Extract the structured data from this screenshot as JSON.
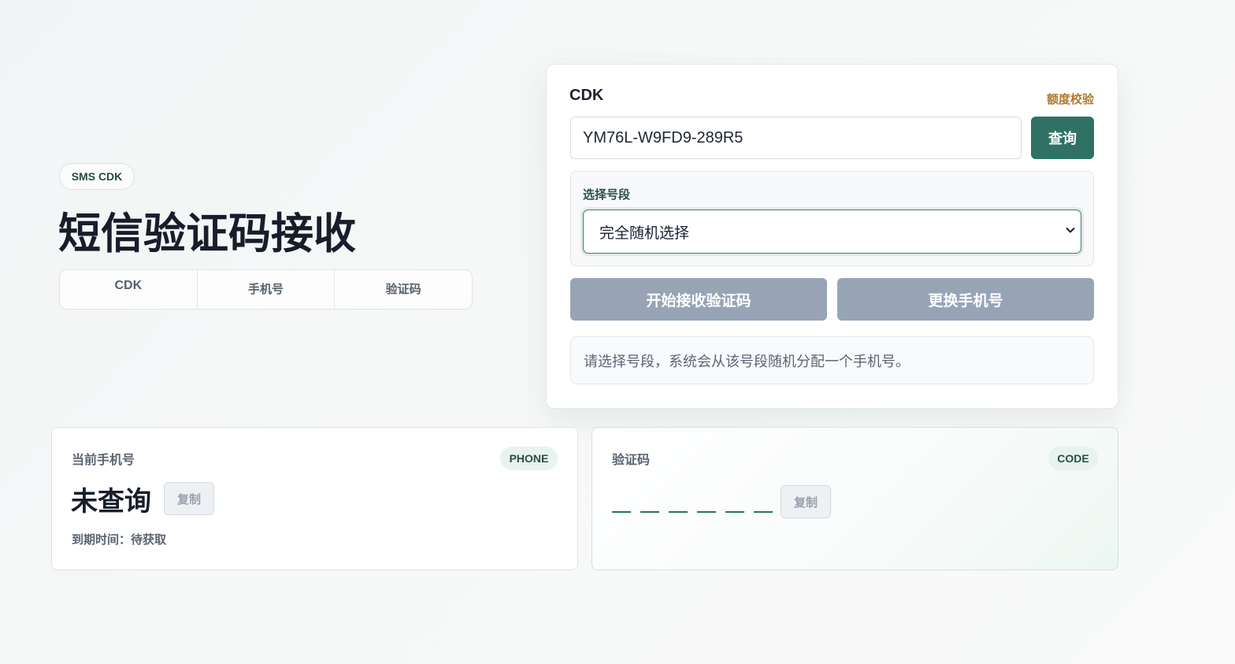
{
  "hero": {
    "badge": "SMS CDK",
    "title": "短信验证码接收",
    "tabs": [
      "CDK",
      "手机号",
      "验证码"
    ]
  },
  "query_card": {
    "cdk_label": "CDK",
    "quota_link": "额度校验",
    "cdk_value": "YM76L-W9FD9-289R5",
    "query_button": "查询",
    "segment_label": "选择号段",
    "segment_selected": "完全随机选择",
    "start_button": "开始接收验证码",
    "change_button": "更换手机号",
    "hint": "请选择号段，系统会从该号段随机分配一个手机号。"
  },
  "phone_card": {
    "title": "当前手机号",
    "badge": "PHONE",
    "value": "未查询",
    "copy_button": "复制",
    "expiry": "到期时间：待获取"
  },
  "code_card": {
    "title": "验证码",
    "badge": "CODE",
    "digit_count": 6,
    "copy_button": "复制"
  },
  "colors": {
    "accent": "#2f7164",
    "disabled_button": "#98a4b6",
    "quota_link": "#b07a2a"
  }
}
